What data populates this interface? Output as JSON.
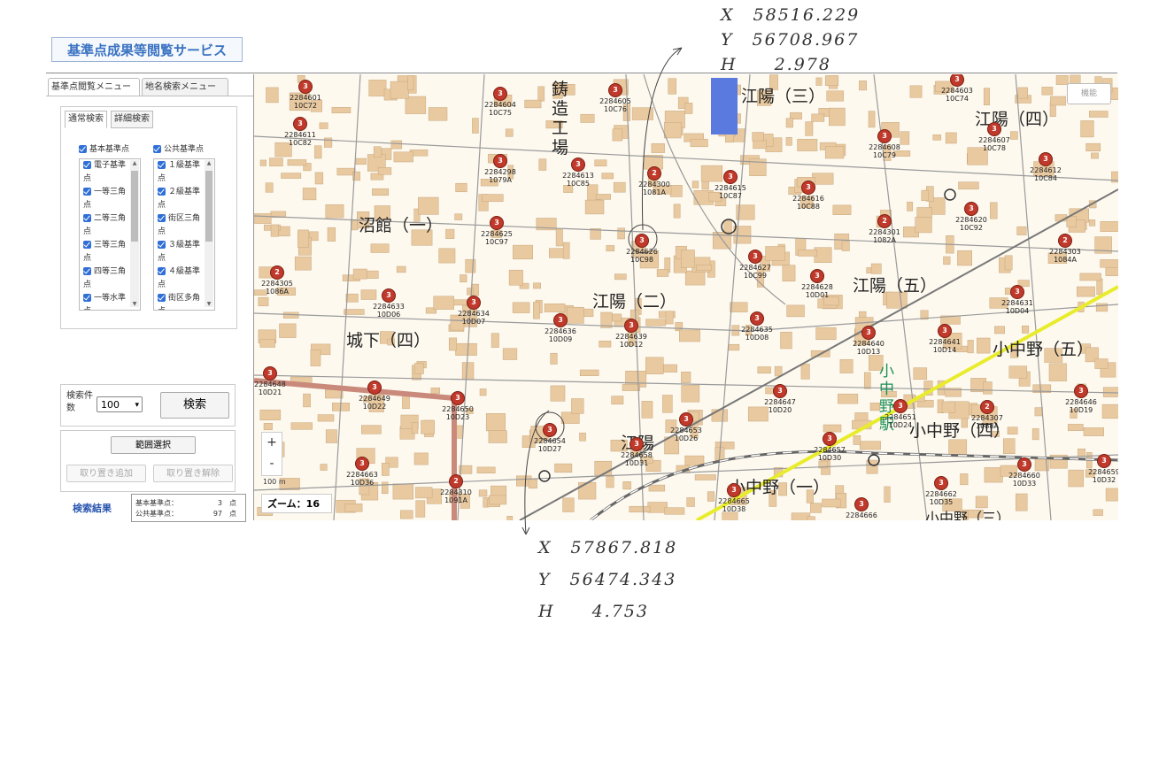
{
  "app": {
    "title": "基準点成果等閲覧サービス"
  },
  "tabs": [
    {
      "label": "基準点閲覧メニュー"
    },
    {
      "label": "地名検索メニュー"
    }
  ],
  "subtabs": [
    {
      "label": "通常検索"
    },
    {
      "label": "詳細検索"
    }
  ],
  "groups": {
    "basic": {
      "label": "基本基準点",
      "items": [
        "電子基準点",
        "一等三角点",
        "二等三角点",
        "三等三角点",
        "四等三角点",
        "一等水準点"
      ]
    },
    "public": {
      "label": "公共基準点",
      "items": [
        "１級基準点",
        "２級基準点",
        "街区三角点",
        "３級基準点",
        "４級基準点",
        "街区多角点"
      ]
    }
  },
  "search": {
    "count_label": "検索件数",
    "count_value": "100",
    "button_label": "検索"
  },
  "range": {
    "select_label": "範囲選択",
    "add_label": "取り置き追加",
    "remove_label": "取り置き解除"
  },
  "results": {
    "label": "検索結果",
    "rows": [
      {
        "name": "基本基準点：",
        "value": "3",
        "unit": "点"
      },
      {
        "name": "公共基準点：",
        "value": "97",
        "unit": "点"
      }
    ]
  },
  "map": {
    "toggle_label": "機能",
    "zoom_in": "+",
    "zoom_out": "-",
    "scale_label": "100 m",
    "zoom_label": "ズーム：16",
    "areas": [
      "沼館（一）",
      "江陽（三）",
      "江陽（四）",
      "江陽（二）",
      "江陽（五）",
      "城下（四）",
      "小中野（五）",
      "小中野（四）",
      "小中野（一）",
      "江陽",
      "小中野（三）"
    ],
    "station": "小中野駅",
    "factory": "鋳造工場",
    "colors": {
      "marker": "#c0392b",
      "road": "#c98a7c",
      "rail_line": "#e8ec2a",
      "building": "#e8c9a0"
    }
  },
  "benchmarks": [
    {
      "n": "3",
      "id": "2284601",
      "sub": "10C72"
    },
    {
      "n": "3",
      "id": "2284604",
      "sub": "10C75"
    },
    {
      "n": "3",
      "id": "2284605",
      "sub": "10C76"
    },
    {
      "n": "3",
      "id": "2284611",
      "sub": "10C82"
    },
    {
      "n": "3",
      "id": "2284298",
      "sub": "1079A"
    },
    {
      "n": "3",
      "id": "2284613",
      "sub": "10C85"
    },
    {
      "n": "2",
      "id": "2284300",
      "sub": "1081A"
    },
    {
      "n": "3",
      "id": "2284615",
      "sub": "10C87"
    },
    {
      "n": "3",
      "id": "2284616",
      "sub": "10C88"
    },
    {
      "n": "3",
      "id": "2284625",
      "sub": "10C97"
    },
    {
      "n": "3",
      "id": "2284626",
      "sub": "10C98"
    },
    {
      "n": "3",
      "id": "2284627",
      "sub": "10C99"
    },
    {
      "n": "2",
      "id": "2284305",
      "sub": "1086A"
    },
    {
      "n": "3",
      "id": "2284633",
      "sub": "10D06"
    },
    {
      "n": "3",
      "id": "2284634",
      "sub": "10D07"
    },
    {
      "n": "3",
      "id": "2284636",
      "sub": "10D09"
    },
    {
      "n": "3",
      "id": "2284639",
      "sub": "10D12"
    },
    {
      "n": "3",
      "id": "2284628",
      "sub": "10D01"
    },
    {
      "n": "3",
      "id": "2284635",
      "sub": "10D08"
    },
    {
      "n": "3",
      "id": "2284603",
      "sub": "10C74"
    },
    {
      "n": "3",
      "id": "2284607",
      "sub": "10C78"
    },
    {
      "n": "3",
      "id": "2284608",
      "sub": "10C79"
    },
    {
      "n": "3",
      "id": "2284612",
      "sub": "10C84"
    },
    {
      "n": "3",
      "id": "2284620",
      "sub": "10C92"
    },
    {
      "n": "2",
      "id": "2284301",
      "sub": "1082A"
    },
    {
      "n": "2",
      "id": "2284303",
      "sub": "1084A"
    },
    {
      "n": "3",
      "id": "2284631",
      "sub": "10D04"
    },
    {
      "n": "3",
      "id": "2284640",
      "sub": "10D13"
    },
    {
      "n": "3",
      "id": "2284641",
      "sub": "10D14"
    },
    {
      "n": "3",
      "id": "2284648",
      "sub": "10D21"
    },
    {
      "n": "3",
      "id": "2284649",
      "sub": "10D22"
    },
    {
      "n": "3",
      "id": "2284650",
      "sub": "10D23"
    },
    {
      "n": "3",
      "id": "2284647",
      "sub": "10D20"
    },
    {
      "n": "3",
      "id": "2284651",
      "sub": "10D24"
    },
    {
      "n": "2",
      "id": "2284307",
      "sub": "1088A"
    },
    {
      "n": "3",
      "id": "2284646",
      "sub": "10D19"
    },
    {
      "n": "3",
      "id": "2284653",
      "sub": "10D26"
    },
    {
      "n": "3",
      "id": "2284654",
      "sub": "10D27"
    },
    {
      "n": "3",
      "id": "2284658",
      "sub": "10D31"
    },
    {
      "n": "3",
      "id": "2284657",
      "sub": "10D30"
    },
    {
      "n": "3",
      "id": "2284663",
      "sub": "10D36"
    },
    {
      "n": "2",
      "id": "2284310",
      "sub": "1091A"
    },
    {
      "n": "3",
      "id": "2284665",
      "sub": "10D38"
    },
    {
      "n": "3",
      "id": "2284666",
      "sub": ""
    },
    {
      "n": "3",
      "id": "2284662",
      "sub": "10D35"
    },
    {
      "n": "3",
      "id": "2284660",
      "sub": "10D33"
    },
    {
      "n": "3",
      "id": "2284659",
      "sub": "10D32"
    }
  ],
  "notes": {
    "top": {
      "x": "X　58516.229",
      "y": "Y　56708.967",
      "h": "H　　2.978"
    },
    "bottom": {
      "x": "X　57867.818",
      "y": "Y　56474.343",
      "h": "H　　4.753"
    }
  }
}
